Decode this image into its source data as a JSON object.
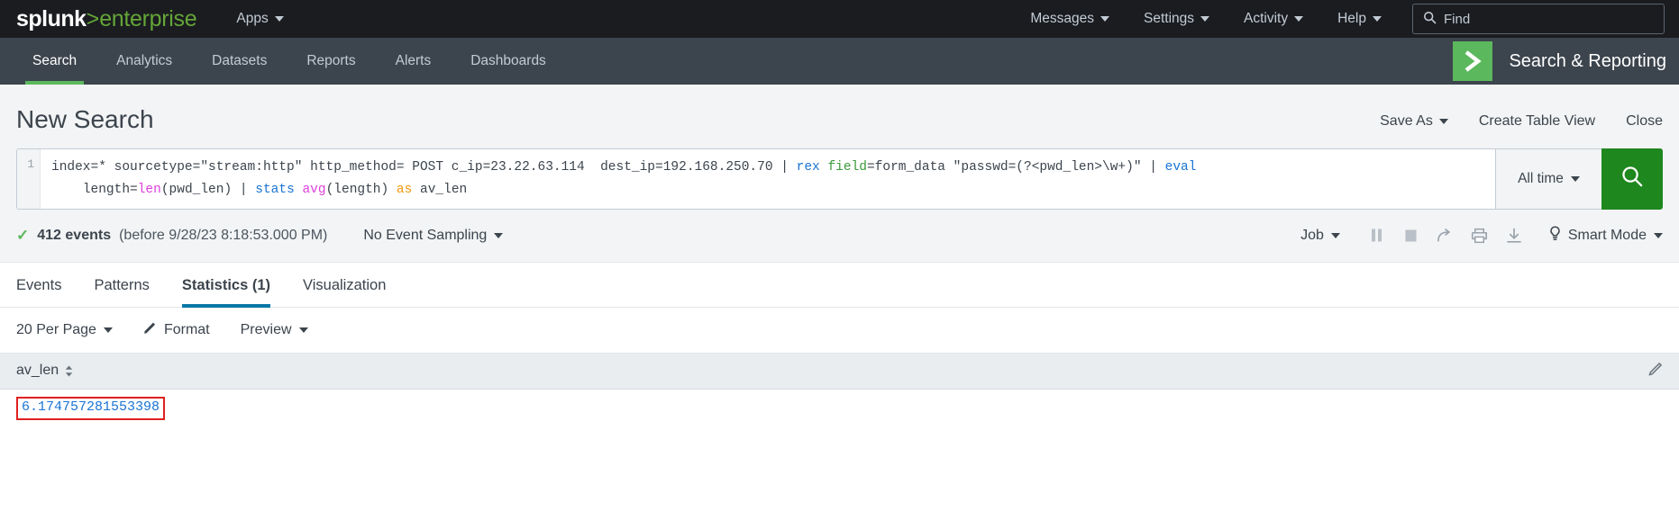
{
  "topbar": {
    "logo": {
      "part1": "splunk",
      "gt": ">",
      "part2": "enterprise"
    },
    "apps_label": "Apps",
    "menus": [
      "Messages",
      "Settings",
      "Activity",
      "Help"
    ],
    "find_placeholder": "Find",
    "find_icon": "search-icon"
  },
  "appnav": {
    "tabs": [
      "Search",
      "Analytics",
      "Datasets",
      "Reports",
      "Alerts",
      "Dashboards"
    ],
    "active_tab": "Search",
    "app_name": "Search & Reporting",
    "app_icon": "chevron-right-logo-icon",
    "accent": "#5cb85c"
  },
  "page": {
    "title": "New Search",
    "actions": [
      {
        "label": "Save As",
        "has_caret": true
      },
      {
        "label": "Create Table View",
        "has_caret": false
      },
      {
        "label": "Close",
        "has_caret": false
      }
    ]
  },
  "search": {
    "line_number": "1",
    "query_full": "index=* sourcetype=\"stream:http\" http_method= POST c_ip=23.22.63.114  dest_ip=192.168.250.70 | rex field=form_data \"passwd=(?<pwd_len>\\w+)\" | eval length=len(pwd_len) | stats avg(length) as av_len",
    "tokens": [
      {
        "t": "index=* sourcetype=\"stream:http\" http_method= POST c_ip=23.22.63.114  dest_ip=192.168.250.70 | ",
        "c": "plain"
      },
      {
        "t": "rex",
        "c": "cmd"
      },
      {
        "t": " ",
        "c": "plain"
      },
      {
        "t": "field",
        "c": "arg"
      },
      {
        "t": "=form_data \"passwd=(?<pwd_len>\\w+)\" | ",
        "c": "plain"
      },
      {
        "t": "eval",
        "c": "cmd"
      },
      {
        "t": "\n    length=",
        "c": "plain"
      },
      {
        "t": "len",
        "c": "fn"
      },
      {
        "t": "(pwd_len) | ",
        "c": "plain"
      },
      {
        "t": "stats",
        "c": "cmd"
      },
      {
        "t": " ",
        "c": "plain"
      },
      {
        "t": "avg",
        "c": "fn"
      },
      {
        "t": "(length) ",
        "c": "plain"
      },
      {
        "t": "as",
        "c": "as"
      },
      {
        "t": " av_len",
        "c": "plain"
      }
    ],
    "time_range": "All time",
    "go_icon": "search-icon",
    "accent_green": "#1e871e"
  },
  "jobbar": {
    "check_icon": "check-icon",
    "event_count": "412 events",
    "event_time": "(before 9/28/23 8:18:53.000 PM)",
    "sampling": "No Event Sampling",
    "job_label": "Job",
    "icons": [
      {
        "name": "pause-icon"
      },
      {
        "name": "stop-icon"
      },
      {
        "name": "share-icon"
      },
      {
        "name": "print-icon"
      },
      {
        "name": "export-download-icon"
      }
    ],
    "mode_icon": "lightbulb-icon",
    "mode_label": "Smart Mode"
  },
  "result_tabs": {
    "tabs": [
      "Events",
      "Patterns",
      "Statistics (1)",
      "Visualization"
    ],
    "active": "Statistics (1)",
    "accent": "#0877a6"
  },
  "table_toolbar": [
    {
      "label": "20 Per Page",
      "icon": "",
      "caret": true
    },
    {
      "label": "Format",
      "icon": "pencil-icon",
      "caret": false
    },
    {
      "label": "Preview",
      "icon": "",
      "caret": true
    }
  ],
  "table": {
    "columns": [
      {
        "label": "av_len",
        "sort_icon": "sort-arrows-icon"
      }
    ],
    "edit_icon": "pencil-icon",
    "rows": [
      {
        "av_len": "6.174757281553398",
        "highlighted": true
      }
    ]
  }
}
